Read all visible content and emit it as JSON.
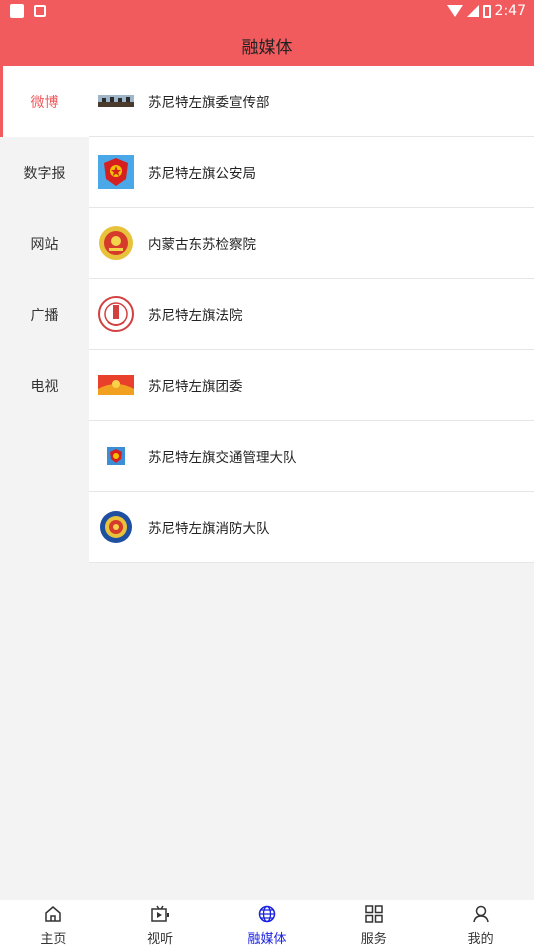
{
  "status": {
    "time": "2:47"
  },
  "header": {
    "title": "融媒体"
  },
  "sidebar": {
    "items": [
      {
        "label": "微博",
        "active": true
      },
      {
        "label": "数字报",
        "active": false
      },
      {
        "label": "网站",
        "active": false
      },
      {
        "label": "广播",
        "active": false
      },
      {
        "label": "电视",
        "active": false
      }
    ]
  },
  "list": {
    "items": [
      {
        "label": "苏尼特左旗委宣传部",
        "icon": "propaganda-logo"
      },
      {
        "label": "苏尼特左旗公安局",
        "icon": "police-badge"
      },
      {
        "label": "内蒙古东苏检察院",
        "icon": "procuratorate-emblem"
      },
      {
        "label": "苏尼特左旗法院",
        "icon": "court-emblem"
      },
      {
        "label": "苏尼特左旗团委",
        "icon": "youth-league-logo"
      },
      {
        "label": "苏尼特左旗交通管理大队",
        "icon": "traffic-police-badge"
      },
      {
        "label": "苏尼特左旗消防大队",
        "icon": "fire-rescue-emblem"
      }
    ]
  },
  "tabbar": {
    "items": [
      {
        "label": "主页",
        "icon": "home-icon",
        "active": false
      },
      {
        "label": "视听",
        "icon": "tv-icon",
        "active": false
      },
      {
        "label": "融媒体",
        "icon": "globe-icon",
        "active": true
      },
      {
        "label": "服务",
        "icon": "grid-icon",
        "active": false
      },
      {
        "label": "我的",
        "icon": "person-icon",
        "active": false
      }
    ]
  },
  "colors": {
    "accent": "#f25b5e",
    "active_tab": "#1a22e0"
  }
}
